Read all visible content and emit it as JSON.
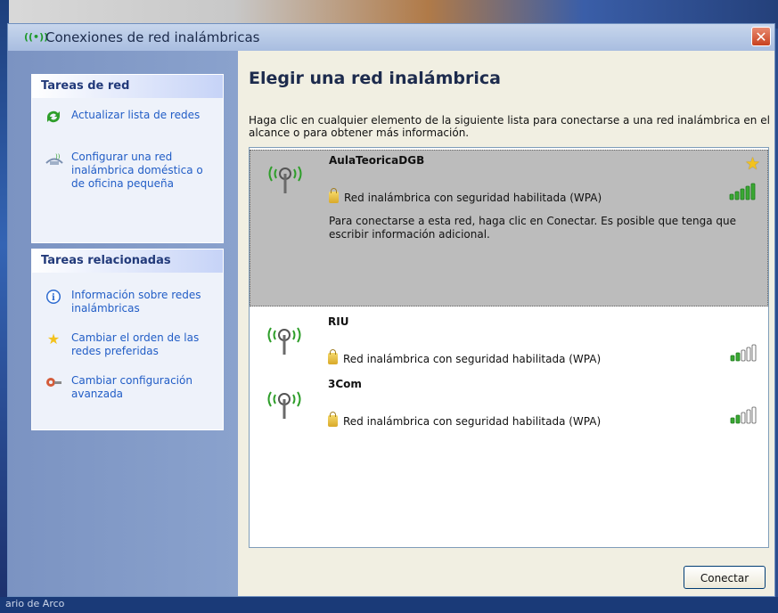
{
  "window": {
    "title": "Conexiones de red inalámbricas",
    "close_label": "✕"
  },
  "desktop": {
    "bottom_text": "ario de Arco"
  },
  "sidebar": {
    "network_tasks": {
      "heading": "Tareas de red",
      "items": [
        {
          "label": "Actualizar lista de redes",
          "icon": "refresh-icon"
        },
        {
          "label": "Configurar una red inalámbrica doméstica o de oficina pequeña",
          "icon": "setup-network-icon"
        }
      ]
    },
    "related_tasks": {
      "heading": "Tareas relacionadas",
      "items": [
        {
          "label": "Información sobre redes inalámbricas",
          "icon": "info-icon"
        },
        {
          "label": "Cambiar el orden de las redes preferidas",
          "icon": "star-icon"
        },
        {
          "label": "Cambiar configuración avanzada",
          "icon": "advanced-settings-icon"
        }
      ]
    }
  },
  "main": {
    "title": "Elegir una red inalámbrica",
    "description": "Haga clic en cualquier elemento de la siguiente lista para conectarse a una red inalámbrica en el alcance o para obtener más información.",
    "networks": [
      {
        "name": "AulaTeoricaDGB",
        "security": "Red inalámbrica con seguridad habilitada (WPA)",
        "signal_bars": 5,
        "preferred": true,
        "selected": true,
        "info": "Para conectarse a esta red, haga clic en Conectar. Es posible que tenga que escribir información adicional."
      },
      {
        "name": "RIU",
        "security": "Red inalámbrica con seguridad habilitada (WPA)",
        "signal_bars": 2,
        "preferred": false,
        "selected": false
      },
      {
        "name": "3Com",
        "security": "Red inalámbrica con seguridad habilitada (WPA)",
        "signal_bars": 2,
        "preferred": false,
        "selected": false
      }
    ],
    "connect_button": "Conectar"
  },
  "colors": {
    "signal_on": "#3aa832",
    "signal_off": "#ffffff",
    "antenna": "#2e9e2a",
    "link": "#215dc6"
  }
}
